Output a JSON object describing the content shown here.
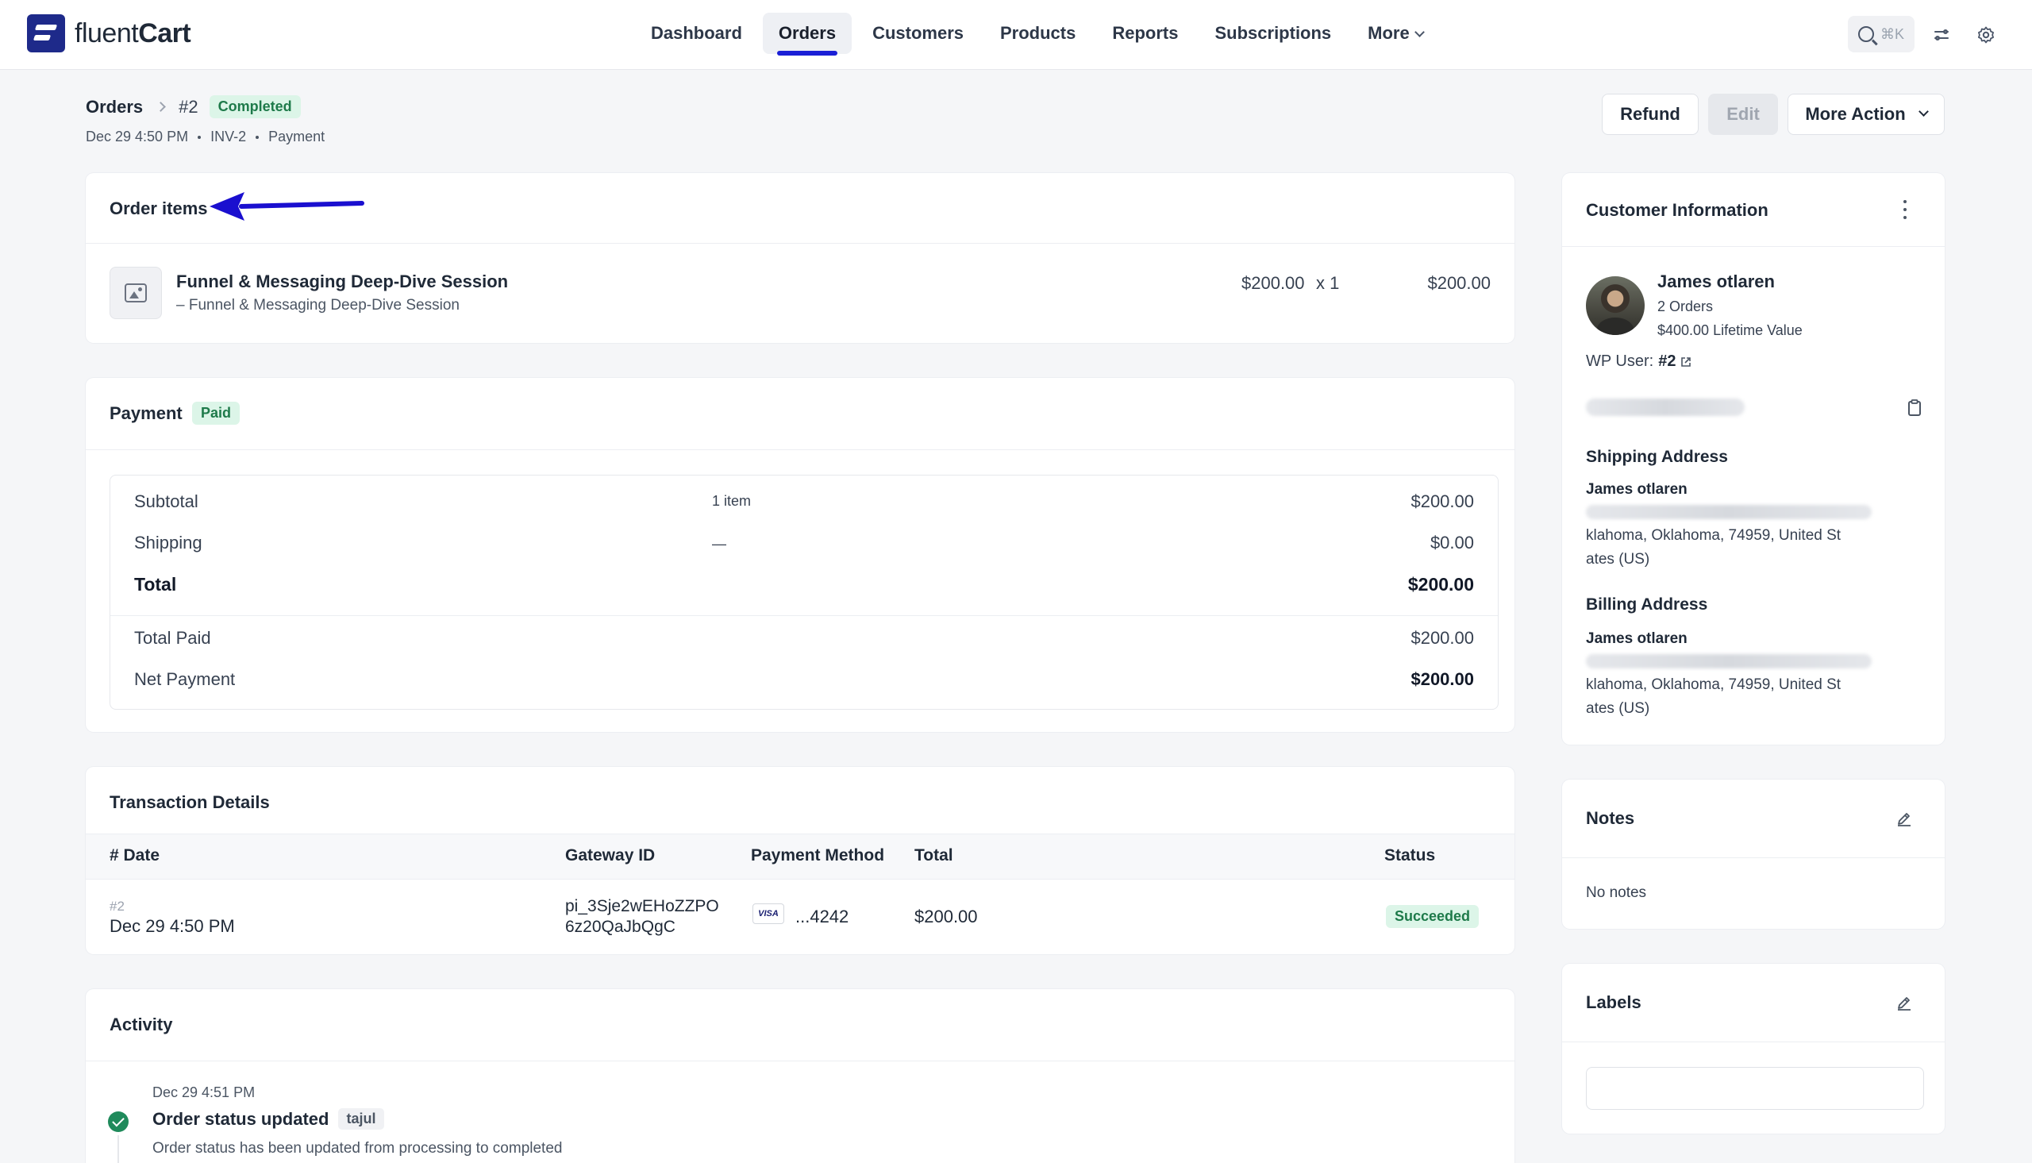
{
  "app": {
    "logo_text_light": "fluent",
    "logo_text_bold": "Cart"
  },
  "nav": {
    "items": [
      "Dashboard",
      "Orders",
      "Customers",
      "Products",
      "Reports",
      "Subscriptions",
      "More"
    ],
    "active": "Orders",
    "search_shortcut": "⌘K"
  },
  "header": {
    "breadcrumb_root": "Orders",
    "order_id": "#2",
    "status": "Completed",
    "date": "Dec 29 4:50 PM",
    "invoice": "INV-2",
    "type": "Payment",
    "buttons": {
      "refund": "Refund",
      "edit": "Edit",
      "more_action": "More Action"
    }
  },
  "order_items": {
    "title": "Order items",
    "items": [
      {
        "name": "Funnel & Messaging Deep-Dive Session",
        "variant": "– Funnel & Messaging Deep-Dive Session",
        "unit_price": "$200.00",
        "qty": "x 1",
        "total": "$200.00"
      }
    ]
  },
  "payment": {
    "title": "Payment",
    "status": "Paid",
    "subtotal_label": "Subtotal",
    "subtotal_count": "1 item",
    "subtotal_value": "$200.00",
    "shipping_label": "Shipping",
    "shipping_mid": "—",
    "shipping_value": "$0.00",
    "total_label": "Total",
    "total_value": "$200.00",
    "total_paid_label": "Total Paid",
    "total_paid_value": "$200.00",
    "net_label": "Net Payment",
    "net_value": "$200.00"
  },
  "transactions": {
    "title": "Transaction Details",
    "columns": [
      "# Date",
      "Gateway ID",
      "Payment Method",
      "Total",
      "Status"
    ],
    "rows": [
      {
        "id": "#2",
        "date": "Dec 29 4:50 PM",
        "gateway_line1": "pi_3Sje2wEHoZZPO",
        "gateway_line2": "6z20QaJbQgC",
        "card_brand": "VISA",
        "card_last4": "...4242",
        "total": "$200.00",
        "status": "Succeeded"
      }
    ]
  },
  "activity": {
    "title": "Activity",
    "entries": [
      {
        "time": "Dec 29 4:51 PM",
        "title": "Order status updated",
        "user": "tajul",
        "desc": "Order status has been updated from processing to completed"
      }
    ]
  },
  "customer": {
    "title": "Customer Information",
    "name": "James otlaren",
    "orders": "2 Orders",
    "lifetime": "$400.00 Lifetime Value",
    "wp_user_label": "WP User:",
    "wp_user_id": "#2",
    "shipping_title": "Shipping Address",
    "shipping_name": "James otlaren",
    "shipping_line1": "klahoma, Oklahoma, 74959, United St",
    "shipping_line2": "ates (US)",
    "billing_title": "Billing Address",
    "billing_name": "James otlaren",
    "billing_line1": "klahoma, Oklahoma, 74959, United St",
    "billing_line2": "ates (US)"
  },
  "notes": {
    "title": "Notes",
    "empty": "No notes"
  },
  "labels": {
    "title": "Labels"
  },
  "colors": {
    "accent": "#1a1fd6",
    "success_bg": "#dcf5e8",
    "success_fg": "#1e7a4a",
    "arrow": "#1a0fcf"
  }
}
